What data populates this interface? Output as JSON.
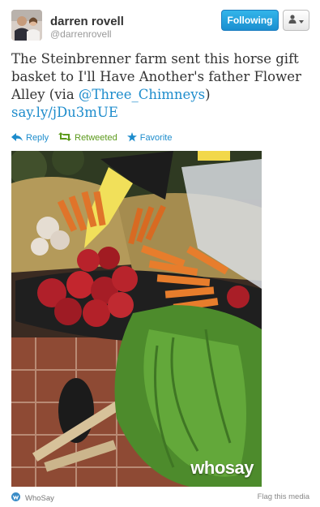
{
  "tweet": {
    "display_name": "darren rovell",
    "handle": "@darrenrovell",
    "text_parts": [
      "The Steinbrenner farm sent this horse gift basket to I'll Have Another's father Flower Alley (via ",
      "@Three_Chimneys",
      ")"
    ],
    "link": "say.ly/jDu3mUE"
  },
  "header": {
    "follow_label": "Following"
  },
  "actions": {
    "reply": "Reply",
    "retweeted": "Retweeted",
    "favorite": "Favorite"
  },
  "media": {
    "watermark": "whosay"
  },
  "footer": {
    "source": "WhoSay",
    "flag": "Flag this media"
  },
  "colors": {
    "link": "#1d8ccc",
    "retweeted": "#5c9a1c",
    "follow_button": "#2aa3e0"
  },
  "icons": [
    "avatar",
    "person-icon",
    "caret-down-icon",
    "reply-icon",
    "retweet-icon",
    "star-icon",
    "whosay-icon"
  ]
}
